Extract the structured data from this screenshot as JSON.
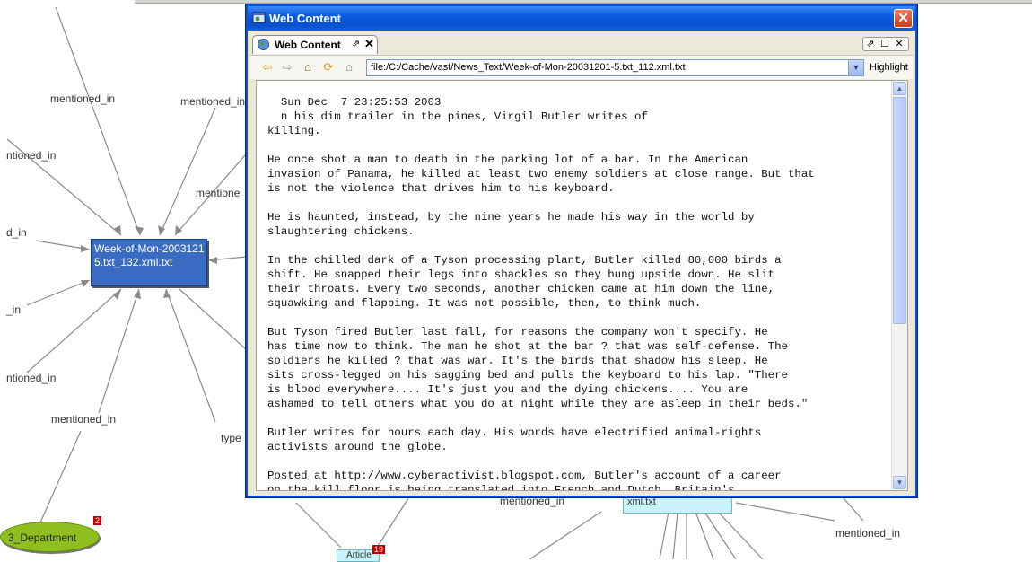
{
  "graph": {
    "edge_labels": [
      "mentioned_in",
      "mentioned_in",
      "ntioned_in",
      "mentione",
      "d_in",
      "_in",
      "ntioned_in",
      "mentioned_in",
      "type",
      "mentioned_in",
      "mentioned_in"
    ],
    "main_node": {
      "label": "Week-of-Mon-20031215.txt_132.xml.txt"
    },
    "dept_node": {
      "label": "3_Department",
      "badge": "2"
    },
    "article_node": {
      "label": "Article",
      "badge": "19"
    },
    "cyan_node": {
      "label": "xml.txt"
    }
  },
  "dialog": {
    "title": "Web Content",
    "close_label": "✕",
    "tab": {
      "label": "Web Content",
      "pin": "⇗",
      "close": "✕"
    },
    "window_controls": [
      "⇗",
      "☐",
      "✕"
    ],
    "toolbar": {
      "back": "⇦",
      "forward": "⇨",
      "home": "⌂",
      "refresh": "⟳",
      "stop": "⌂",
      "url": "file:/C:/Cache/vast/News_Text/Week-of-Mon-20031201-5.txt_112.xml.txt",
      "url_dropdown": "▼",
      "highlight_label": "Highlight"
    },
    "document_text": "  Sun Dec  7 23:25:53 2003\n  n his dim trailer in the pines, Virgil Butler writes of\nkilling.\n\nHe once shot a man to death in the parking lot of a bar. In the American\ninvasion of Panama, he killed at least two enemy soldiers at close range. But that\nis not the violence that drives him to his keyboard.\n\nHe is haunted, instead, by the nine years he made his way in the world by\nslaughtering chickens.\n\nIn the chilled dark of a Tyson processing plant, Butler killed 80,000 birds a\nshift. He snapped their legs into shackles so they hung upside down. He slit\ntheir throats. Every two seconds, another chicken came at him down the line,\nsquawking and flapping. It was not possible, then, to think much.\n\nBut Tyson fired Butler last fall, for reasons the company won't specify. He\nhas time now to think. The man he shot at the bar ? that was self-defense. The\nsoldiers he killed ? that was war. It's the birds that shadow his sleep. He\nsits cross-legged on his sagging bed and pulls the keyboard to his lap. \"There\nis blood everywhere.... It's just you and the dying chickens.... You are\nashamed to tell others what you do at night while they are asleep in their beds.\"\n\nButler writes for hours each day. His words have electrified animal-rights\nactivists around the globe.\n\nPosted at http://www.cyberactivist.blogspot.com, Butler's account of a career\non the kill floor is being translated into French and Dutch. Britain's",
    "scroll": {
      "up": "▲",
      "down": "▼",
      "position": 0.0
    }
  },
  "colors": {
    "title_blue": "#0a5be0",
    "node_blue": "#3b6cc4",
    "dept_green": "#8fbf1e",
    "close_red": "#c9401d"
  }
}
